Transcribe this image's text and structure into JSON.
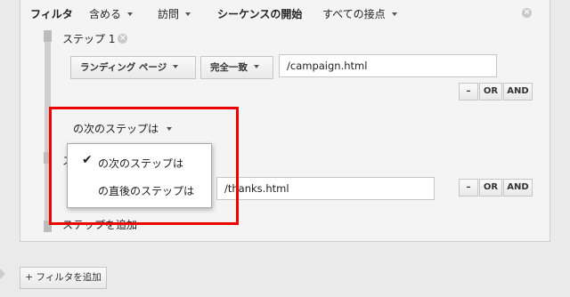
{
  "filter_header": {
    "title": "フィルタ",
    "include": "含める",
    "type": "訪問",
    "sequence_start": "シーケンスの開始",
    "start_option": "すべての接点"
  },
  "step1": {
    "label": "ステップ 1",
    "dimension": "ランディング ページ",
    "match_type": "完全一致",
    "value": "/campaign.html"
  },
  "step2": {
    "label_partial": "ス",
    "relation": "の次のステップは",
    "value": "/thanks.html"
  },
  "relation_menu": {
    "options": [
      "の次のステップは",
      "の直後のステップは"
    ],
    "selected_index": 0
  },
  "buttons": {
    "minus": "–",
    "or": "OR",
    "and": "AND",
    "add_step": "ステップを追加",
    "add_filter": "+ フィルタを追加"
  },
  "icons": {
    "check": "✔",
    "close": "×"
  },
  "colors": {
    "highlight_border": "#e00000"
  }
}
